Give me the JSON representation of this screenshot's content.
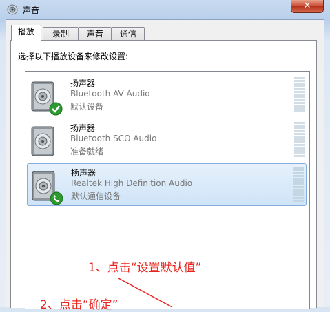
{
  "window": {
    "title": "声音",
    "close_label": "✕"
  },
  "tabs": [
    {
      "label": "播放",
      "active": true
    },
    {
      "label": "录制",
      "active": false
    },
    {
      "label": "声音",
      "active": false
    },
    {
      "label": "通信",
      "active": false
    }
  ],
  "panel": {
    "instruction": "选择以下播放设备来修改设置:"
  },
  "devices": [
    {
      "name": "扬声器",
      "description": "Bluetooth AV Audio",
      "status": "默认设备",
      "badge": "checkmark-icon",
      "selected": false
    },
    {
      "name": "扬声器",
      "description": "Bluetooth SCO Audio",
      "status": "准备就绪",
      "badge": "",
      "selected": false
    },
    {
      "name": "扬声器",
      "description": "Realtek High Definition Audio",
      "status": "默认通信设备",
      "badge": "phone-icon",
      "selected": true
    }
  ],
  "annotations": {
    "step1": "1、点击“设置默认值”",
    "step2": "2、点击“确定”"
  },
  "colors": {
    "annotation": "#e8251e",
    "selection": "#cfe4f8",
    "close_button": "#c7492f"
  }
}
